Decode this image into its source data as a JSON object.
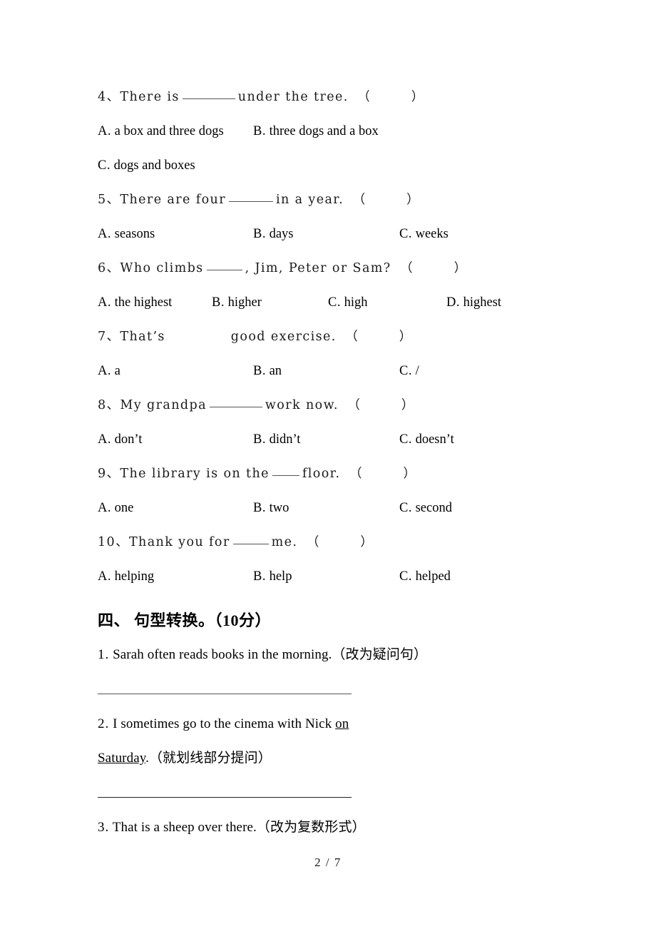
{
  "page": {
    "footer_label": "2 / 7"
  },
  "multiple_choice": {
    "questions": [
      {
        "stem_pre": "4、There is",
        "stem_post": "under the tree.",
        "blank_size": "w-l",
        "bracket_open": "（",
        "bracket_close": "）",
        "options": [
          {
            "label": "A.",
            "text": "a box and three dogs"
          },
          {
            "label": "B.",
            "text": "three dogs and a box"
          },
          {
            "label": "C.",
            "text": "dogs and boxes"
          }
        ]
      },
      {
        "stem_pre": "5、There are four",
        "stem_post": "in a year.",
        "blank_size": "w-m",
        "options": [
          {
            "label": "A.",
            "text": "seasons"
          },
          {
            "label": "B.",
            "text": "days"
          },
          {
            "label": "C.",
            "text": "weeks"
          }
        ]
      },
      {
        "stem_pre": "6、Who climbs",
        "stem_post": ", Jim, Peter or Sam?",
        "blank_size": "w-s",
        "options": [
          {
            "label": "A.",
            "text": "the highest"
          },
          {
            "label": "B.",
            "text": "higher"
          },
          {
            "label": "C.",
            "text": "high"
          },
          {
            "label": "D.",
            "text": "highest"
          }
        ]
      },
      {
        "stem_pre": "7、That’s",
        "stem_post": "good exercise.",
        "blank_size": "gap",
        "options": [
          {
            "label": "A.",
            "text": "a"
          },
          {
            "label": "B.",
            "text": "an"
          },
          {
            "label": "C.",
            "text": "/"
          }
        ]
      },
      {
        "stem_pre": "8、My grandpa",
        "stem_post": "work now.",
        "blank_size": "w-l",
        "options": [
          {
            "label": "A.",
            "text": "don’t"
          },
          {
            "label": "B.",
            "text": "didn’t"
          },
          {
            "label": "C.",
            "text": "doesn’t"
          }
        ]
      },
      {
        "stem_pre": "9、The library is on the",
        "stem_post": "floor.",
        "blank_size": "w-xs",
        "options": [
          {
            "label": "A.",
            "text": "one"
          },
          {
            "label": "B.",
            "text": "two"
          },
          {
            "label": "C.",
            "text": "second"
          }
        ]
      },
      {
        "stem_pre": "10、Thank you for",
        "stem_post": "me.",
        "blank_size": "w-s",
        "options": [
          {
            "label": "A.",
            "text": "helping"
          },
          {
            "label": "B.",
            "text": "help"
          },
          {
            "label": "C.",
            "text": "helped"
          }
        ]
      }
    ]
  },
  "section_four": {
    "heading": "四、 句型转换。（10分）",
    "items": [
      {
        "num": "1.",
        "text_plain": "Sarah often reads books in the morning.（改为疑问句）"
      },
      {
        "num": "2.",
        "line1_pre": "I sometimes go to the cinema with Nick ",
        "line1_underlined": "on ",
        "line2_underlined": "Saturday",
        "line2_post": ".（就划线部分提问）"
      },
      {
        "num": "3.",
        "text_plain": "That is a sheep over there.（改为复数形式）"
      }
    ]
  }
}
